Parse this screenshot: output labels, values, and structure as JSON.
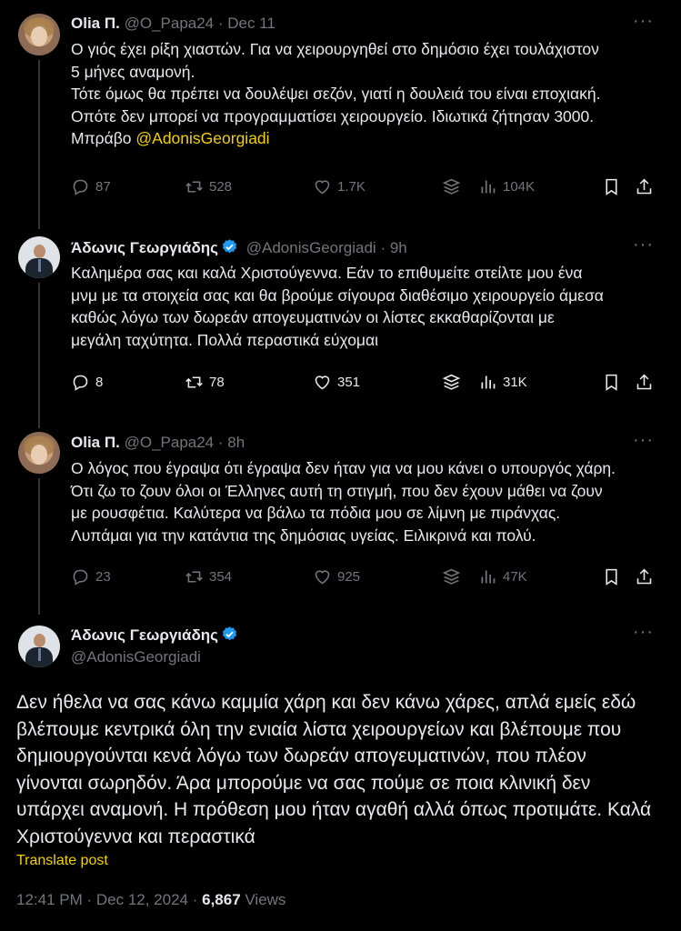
{
  "tweets": [
    {
      "name": "Olia Π.",
      "handle": "@O_Papa24",
      "time": "· Dec 11",
      "text_lines": [
        "Ο γιός έχει ρίξη χιαστών. Για να χειρουργηθεί στο δημόσιο έχει τουλάχιστον",
        "5 μήνες αναμονή.",
        "Τότε όμως θα πρέπει να δουλέψει σεζόν, γιατί η δουλειά του είναι εποχιακή.",
        "Οπότε δεν μπορεί να προγραμματίσει χειρουργείο. Ιδιωτικά ζήτησαν 3000."
      ],
      "last_line_prefix": "Μπράβο ",
      "mention": "@AdonisGeorgiadi",
      "replies": "87",
      "retweets": "528",
      "likes": "1.7K",
      "views": "104K"
    },
    {
      "name": "Άδωνις Γεωργιάδης",
      "handle": "@AdonisGeorgiadi",
      "time": "· 9h",
      "text_lines": [
        "Καλημέρα σας και καλά Χριστούγεννα. Εάν το επιθυμείτε στείλτε μου ένα",
        "μνμ με τα στοιχεία σας και θα βρούμε σίγουρα διαθέσιμο χειρουργείο άμεσα",
        "καθώς λόγω των δωρεάν απογευματινών οι λίστες εκκαθαρίζονται με",
        "μεγάλη ταχύτητα. Πολλά περαστικά εύχομαι"
      ],
      "replies": "8",
      "retweets": "78",
      "likes": "351",
      "views": "31K"
    },
    {
      "name": "Olia Π.",
      "handle": "@O_Papa24",
      "time": "· 8h",
      "text_lines": [
        "Ο λόγος που έγραψα ότι έγραψα δεν ήταν για να μου κάνει ο υπουργός χάρη.",
        "Ότι ζω το ζουν όλοι οι Έλληνες αυτή τη στιγμή, που δεν έχουν μάθει να ζουν",
        "με ρουσφέτια. Καλύτερα να βάλω τα πόδια μου σε λίμνη με πιράνχας.",
        "Λυπάμαι για την κατάντια της δημόσιας υγείας. Ειλικρινά και πολύ."
      ],
      "replies": "23",
      "retweets": "354",
      "likes": "925",
      "views": "47K"
    }
  ],
  "main_tweet": {
    "name": "Άδωνις Γεωργιάδης",
    "handle": "@AdonisGeorgiadi",
    "text_lines": [
      "Δεν ήθελα να σας κάνω καμμία χάρη και δεν κάνω χάρες, απλά εμείς εδώ",
      "βλέπουμε κεντρικά όλη την ενιαία λίστα χειρουργείων και βλέπουμε που",
      "δημιουργούνται κενά λόγω των δωρεάν απογευματινών, που πλέον",
      "γίνονται σωρηδόν. Άρα μπορούμε να σας πούμε σε ποια κλινική δεν",
      "υπάρχει αναμονή. Η πρόθεση μου ήταν αγαθή αλλά όπως προτιμάτε. Καλά",
      "Χριστούγεννα και περαστικά"
    ],
    "translate": "Translate post",
    "timestamp": "12:41 PM · Dec 12, 2024 · ",
    "views_count": "6,867",
    "views_label": " Views"
  },
  "colors": {
    "accent": "#f2d100",
    "verified": "#1d9bf0",
    "muted": "#71767b"
  },
  "more_icon": "more-dots-icon"
}
